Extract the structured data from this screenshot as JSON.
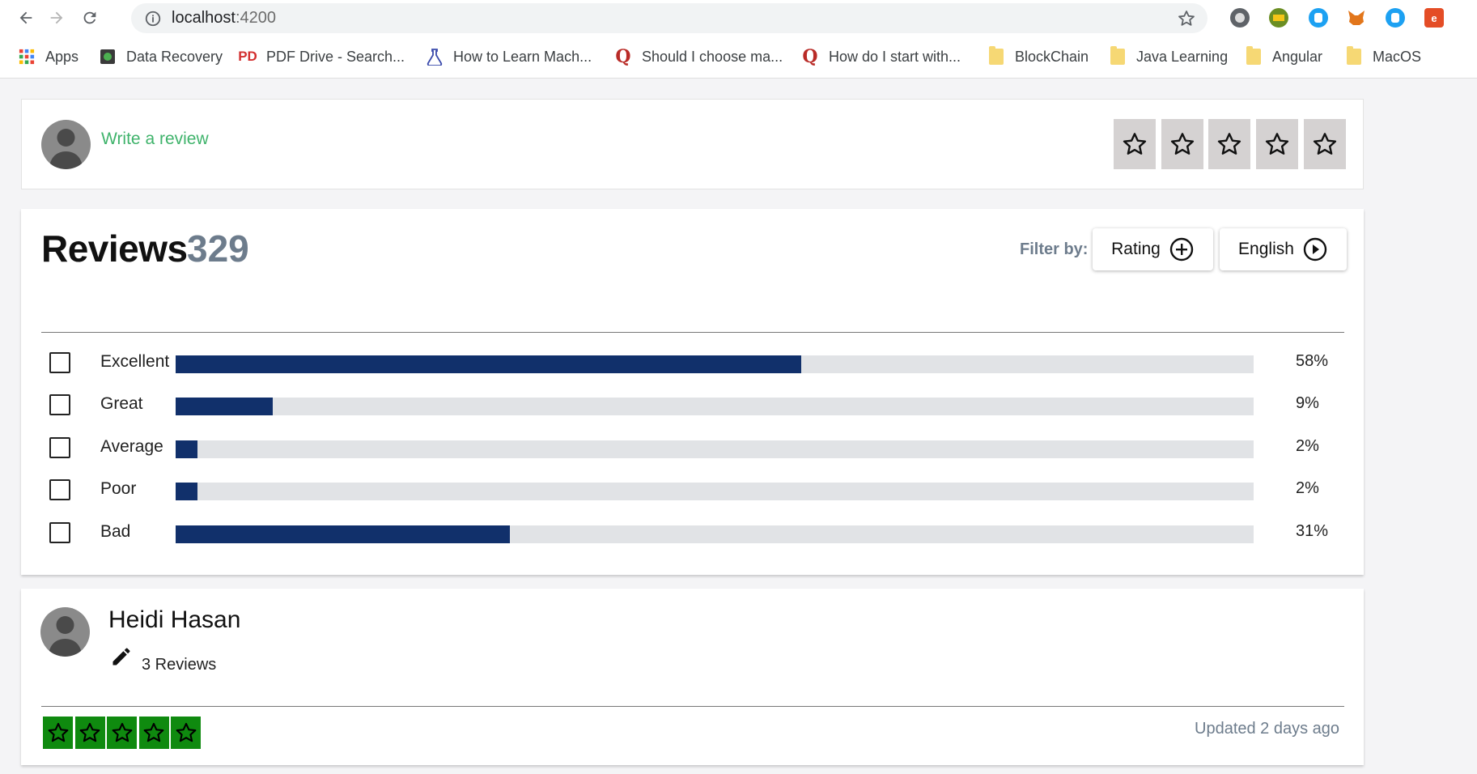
{
  "browser": {
    "url_host": "localhost",
    "url_port": ":4200",
    "bookmarks": [
      {
        "label": "Apps",
        "icon": "apps-grid-icon"
      },
      {
        "label": "Data Recovery",
        "icon": "data-recovery-icon"
      },
      {
        "label": "PDF Drive - Search...",
        "icon": "pdf-drive-icon"
      },
      {
        "label": "How to Learn Mach...",
        "icon": "flask-icon"
      },
      {
        "label": "Should I choose ma...",
        "icon": "quora-icon"
      },
      {
        "label": "How do I start with...",
        "icon": "quora-icon"
      },
      {
        "label": "BlockChain",
        "icon": "folder-icon"
      },
      {
        "label": "Java Learning",
        "icon": "folder-icon"
      },
      {
        "label": "Angular",
        "icon": "folder-icon"
      },
      {
        "label": "MacOS",
        "icon": "folder-icon"
      }
    ],
    "pdf_icon_text": "PD",
    "quora_icon_text": "Q",
    "extension_e_text": "e"
  },
  "write_review": {
    "link_label": "Write a review",
    "star_count": 5
  },
  "reviews": {
    "title": "Reviews",
    "count": "329",
    "filter_label": "Filter by:",
    "filter_rating_label": "Rating",
    "filter_language_label": "English",
    "breakdown": [
      {
        "label": "Excellent",
        "percent": 58,
        "percent_text": "58%"
      },
      {
        "label": "Great",
        "percent": 9,
        "percent_text": "9%"
      },
      {
        "label": "Average",
        "percent": 2,
        "percent_text": "2%"
      },
      {
        "label": "Poor",
        "percent": 2,
        "percent_text": "2%"
      },
      {
        "label": "Bad",
        "percent": 31,
        "percent_text": "31%"
      }
    ]
  },
  "review": {
    "reviewer_name": "Heidi Hasan",
    "review_count": "3 Reviews",
    "stars": 5,
    "updated": "Updated 2 days ago"
  },
  "colors": {
    "link_green": "#3fb36b",
    "bar_fill": "#11306b",
    "bar_track": "#e1e3e6",
    "star_green": "#0f8a0f",
    "muted": "#6d7c8c"
  }
}
